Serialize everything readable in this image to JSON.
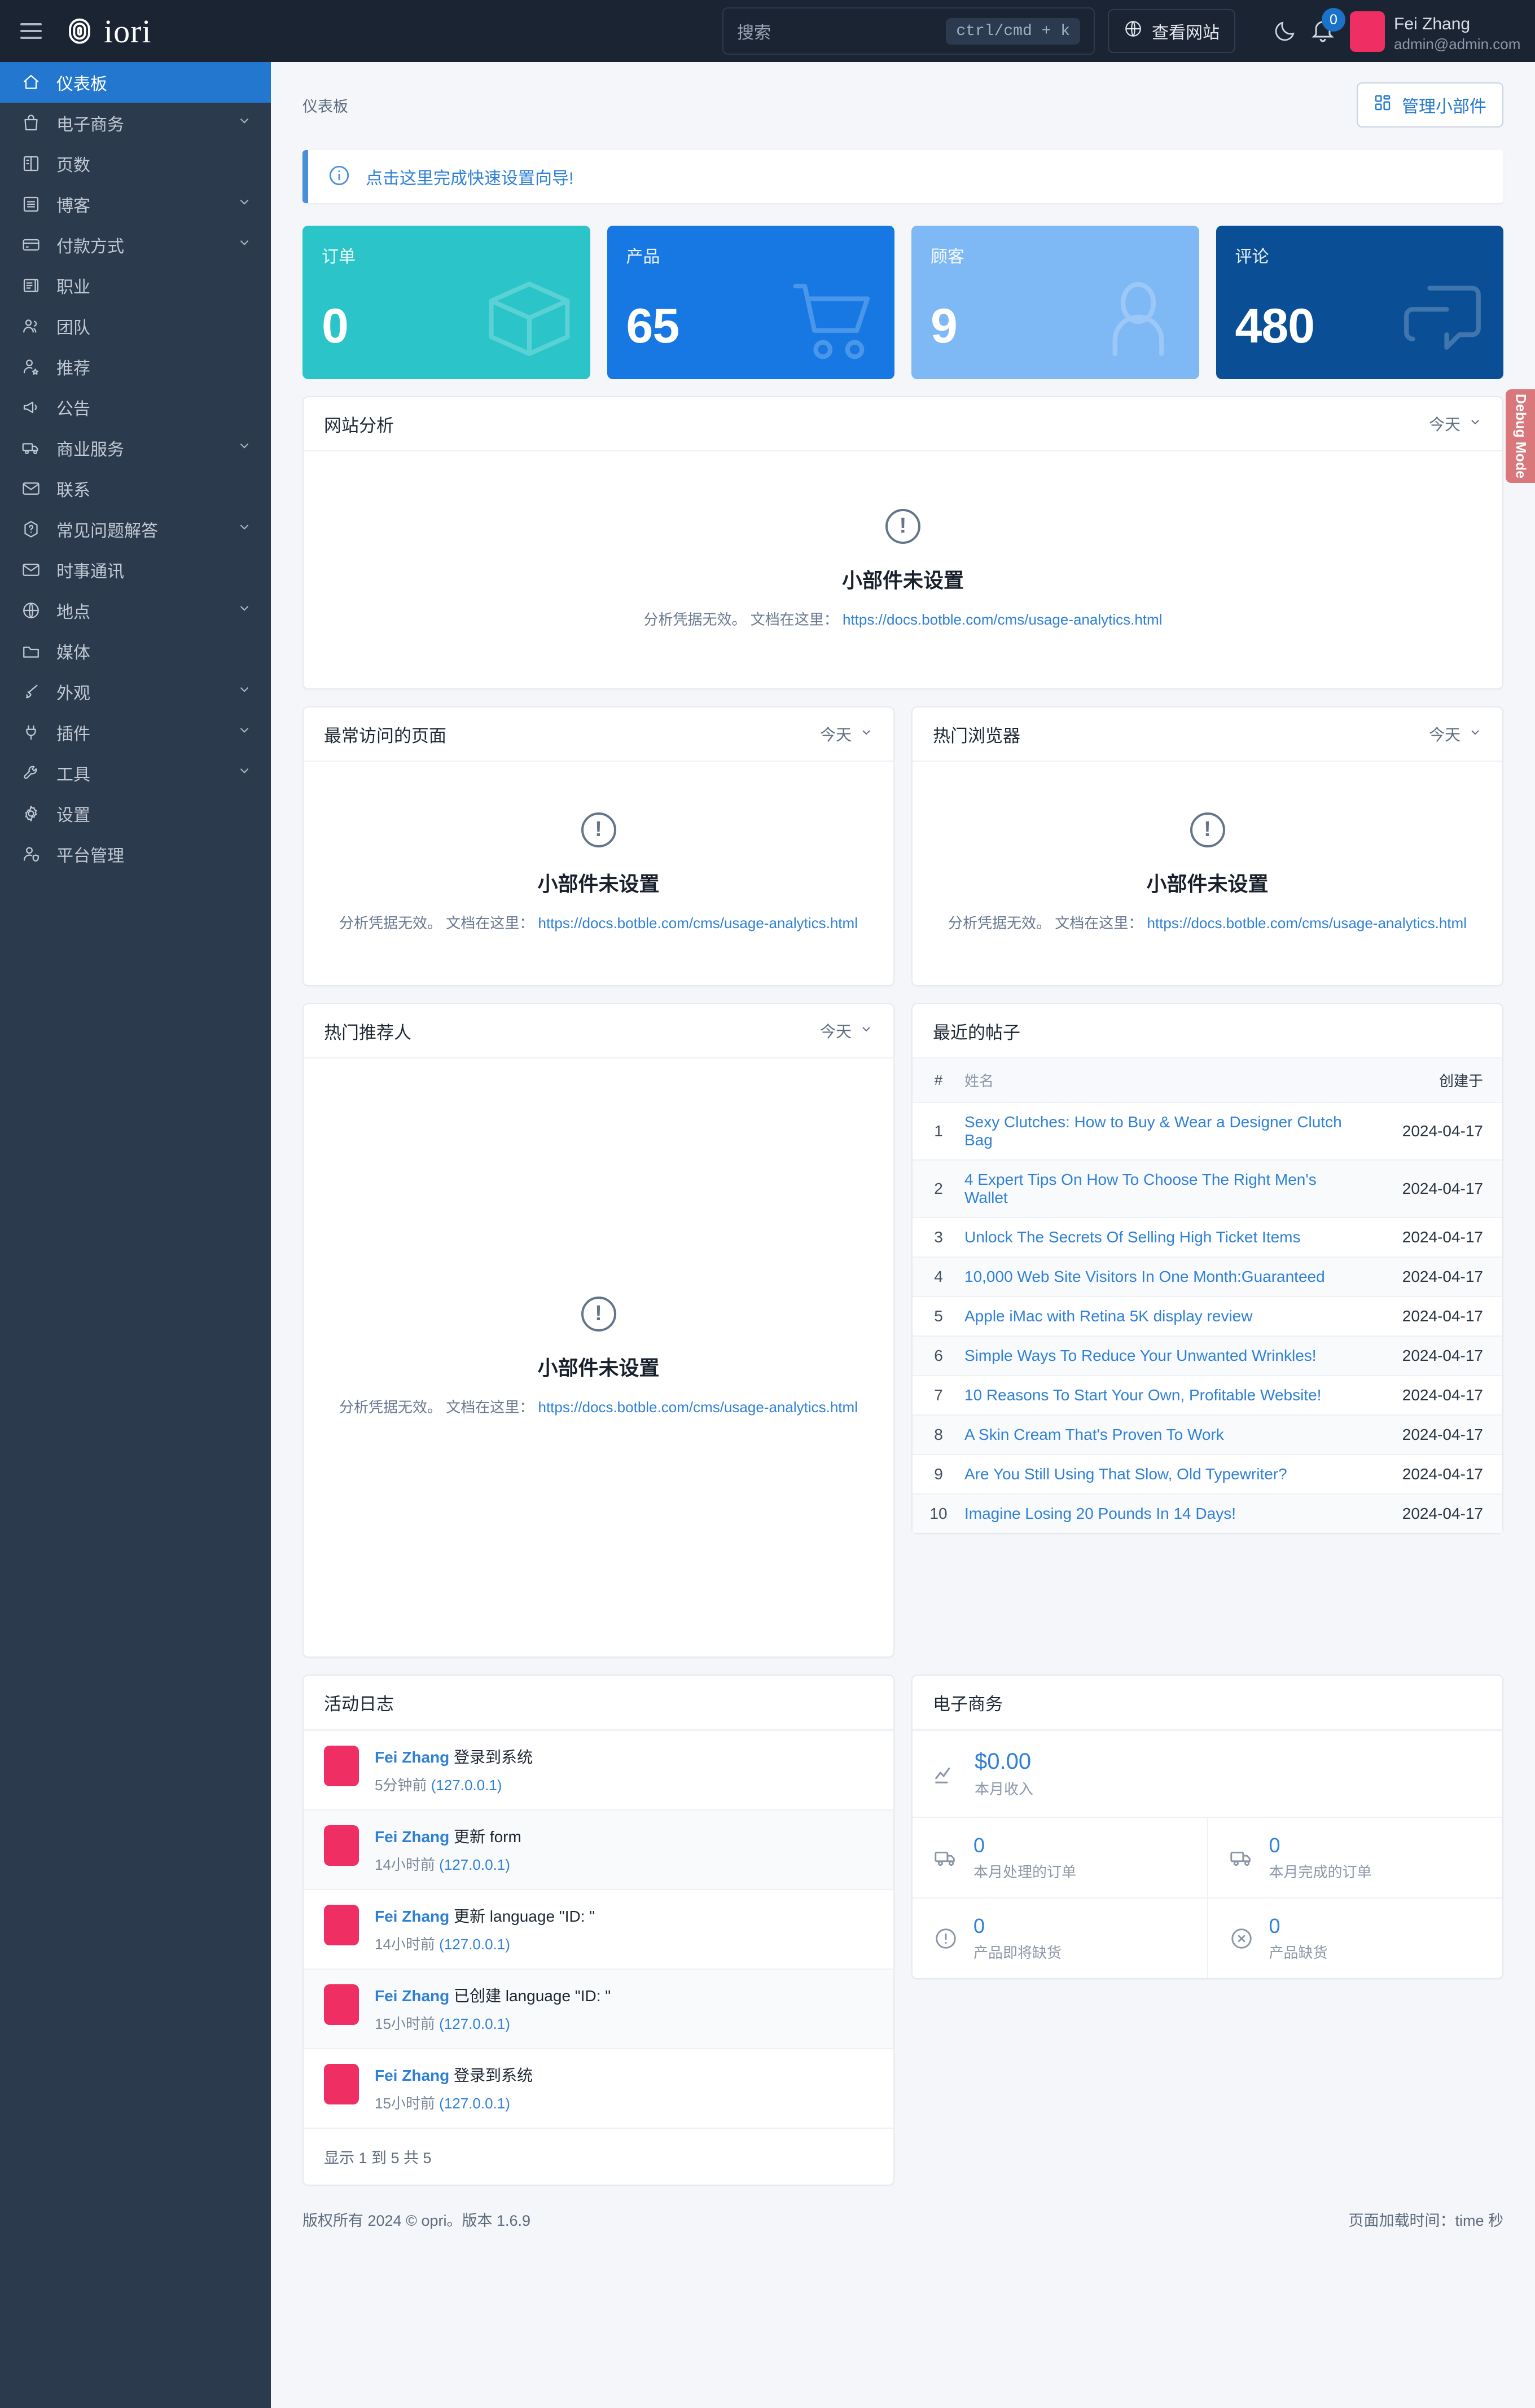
{
  "topbar": {
    "brand": "iori",
    "search": {
      "placeholder": "搜索",
      "shortcut": "ctrl/cmd + k"
    },
    "view_site_label": "查看网站",
    "notification_count": "0",
    "user": {
      "name": "Fei Zhang",
      "email": "admin@admin.com"
    }
  },
  "sidebar": {
    "items": [
      {
        "label": "仪表板",
        "icon": "home-icon",
        "active": true,
        "expandable": false
      },
      {
        "label": "电子商务",
        "icon": "bag-icon",
        "active": false,
        "expandable": true
      },
      {
        "label": "页数",
        "icon": "book-icon",
        "active": false,
        "expandable": false
      },
      {
        "label": "博客",
        "icon": "list-icon",
        "active": false,
        "expandable": true
      },
      {
        "label": "付款方式",
        "icon": "card-icon",
        "active": false,
        "expandable": true
      },
      {
        "label": "职业",
        "icon": "briefcase-icon",
        "active": false,
        "expandable": false
      },
      {
        "label": "团队",
        "icon": "users-icon",
        "active": false,
        "expandable": false
      },
      {
        "label": "推荐",
        "icon": "user-star-icon",
        "active": false,
        "expandable": false
      },
      {
        "label": "公告",
        "icon": "megaphone-icon",
        "active": false,
        "expandable": false
      },
      {
        "label": "商业服务",
        "icon": "truck-icon",
        "active": false,
        "expandable": true
      },
      {
        "label": "联系",
        "icon": "mail-icon",
        "active": false,
        "expandable": false
      },
      {
        "label": "常见问题解答",
        "icon": "question-icon",
        "active": false,
        "expandable": true
      },
      {
        "label": "时事通讯",
        "icon": "mail-icon",
        "active": false,
        "expandable": false
      },
      {
        "label": "地点",
        "icon": "globe-icon",
        "active": false,
        "expandable": true
      },
      {
        "label": "媒体",
        "icon": "folder-icon",
        "active": false,
        "expandable": false
      },
      {
        "label": "外观",
        "icon": "brush-icon",
        "active": false,
        "expandable": true
      },
      {
        "label": "插件",
        "icon": "plug-icon",
        "active": false,
        "expandable": true
      },
      {
        "label": "工具",
        "icon": "wrench-icon",
        "active": false,
        "expandable": true
      },
      {
        "label": "设置",
        "icon": "gear-icon",
        "active": false,
        "expandable": false
      },
      {
        "label": "平台管理",
        "icon": "user-shield-icon",
        "active": false,
        "expandable": false
      }
    ]
  },
  "page": {
    "breadcrumb": "仪表板",
    "manage_widgets_label": "管理小部件",
    "alert_text": "点击这里完成快速设置向导!",
    "debug_tab": "Debug Mode"
  },
  "stat_cards": [
    {
      "title": "订单",
      "value": "0",
      "color": "#2bc4c9",
      "icon": "box-icon"
    },
    {
      "title": "产品",
      "value": "65",
      "color": "#1778e3",
      "icon": "cart-icon"
    },
    {
      "title": "顾客",
      "value": "9",
      "color": "#7fb9f5",
      "icon": "person-icon"
    },
    {
      "title": "评论",
      "value": "480",
      "color": "#0a4f96",
      "icon": "comment-icon"
    }
  ],
  "widgets": {
    "analytics": {
      "title": "网站分析",
      "period": "今天"
    },
    "top_pages": {
      "title": "最常访问的页面",
      "period": "今天"
    },
    "browsers": {
      "title": "热门浏览器",
      "period": "今天"
    },
    "referrers": {
      "title": "热门推荐人",
      "period": "今天"
    },
    "empty_title": "小部件未设置",
    "empty_prefix": "分析凭据无效。 文档在这里：",
    "empty_link": "https://docs.botble.com/cms/usage-analytics.html"
  },
  "recent_posts": {
    "title": "最近的帖子",
    "columns": {
      "num": "#",
      "name": "姓名",
      "created": "创建于"
    },
    "rows": [
      {
        "num": "1",
        "name": "Sexy Clutches: How to Buy & Wear a Designer Clutch Bag",
        "created": "2024-04-17"
      },
      {
        "num": "2",
        "name": "4 Expert Tips On How To Choose The Right Men's Wallet",
        "created": "2024-04-17"
      },
      {
        "num": "3",
        "name": "Unlock The Secrets Of Selling High Ticket Items",
        "created": "2024-04-17"
      },
      {
        "num": "4",
        "name": "10,000 Web Site Visitors In One Month:Guaranteed",
        "created": "2024-04-17"
      },
      {
        "num": "5",
        "name": "Apple iMac with Retina 5K display review",
        "created": "2024-04-17"
      },
      {
        "num": "6",
        "name": "Simple Ways To Reduce Your Unwanted Wrinkles!",
        "created": "2024-04-17"
      },
      {
        "num": "7",
        "name": "10 Reasons To Start Your Own, Profitable Website!",
        "created": "2024-04-17"
      },
      {
        "num": "8",
        "name": "A Skin Cream That's Proven To Work",
        "created": "2024-04-17"
      },
      {
        "num": "9",
        "name": "Are You Still Using That Slow, Old Typewriter?",
        "created": "2024-04-17"
      },
      {
        "num": "10",
        "name": "Imagine Losing 20 Pounds In 14 Days!",
        "created": "2024-04-17"
      }
    ]
  },
  "activity_log": {
    "title": "活动日志",
    "rows": [
      {
        "user": "Fei Zhang",
        "action": "登录到系统",
        "time": "5分钟前",
        "ip": "(127.0.0.1)"
      },
      {
        "user": "Fei Zhang",
        "action": "更新 form",
        "time": "14小时前",
        "ip": "(127.0.0.1)"
      },
      {
        "user": "Fei Zhang",
        "action": "更新 language \"ID: \"",
        "time": "14小时前",
        "ip": "(127.0.0.1)"
      },
      {
        "user": "Fei Zhang",
        "action": "已创建 language \"ID: \"",
        "time": "15小时前",
        "ip": "(127.0.0.1)"
      },
      {
        "user": "Fei Zhang",
        "action": "登录到系统",
        "time": "15小时前",
        "ip": "(127.0.0.1)"
      }
    ],
    "footer": "显示 1 到 5 共 5"
  },
  "ecommerce": {
    "title": "电子商务",
    "revenue": {
      "value": "$0.00",
      "label": "本月收入",
      "icon": "chart-line-icon"
    },
    "cells": [
      {
        "value": "0",
        "label": "本月处理的订单",
        "icon": "truck-icon"
      },
      {
        "value": "0",
        "label": "本月完成的订单",
        "icon": "truck-icon"
      },
      {
        "value": "0",
        "label": "产品即将缺货",
        "icon": "alert-circle-icon"
      },
      {
        "value": "0",
        "label": "产品缺货",
        "icon": "x-circle-icon"
      }
    ]
  },
  "footer": {
    "copyright": "版权所有 2024 © opri。版本 1.6.9",
    "load_time": "页面加载时间：time 秒"
  }
}
